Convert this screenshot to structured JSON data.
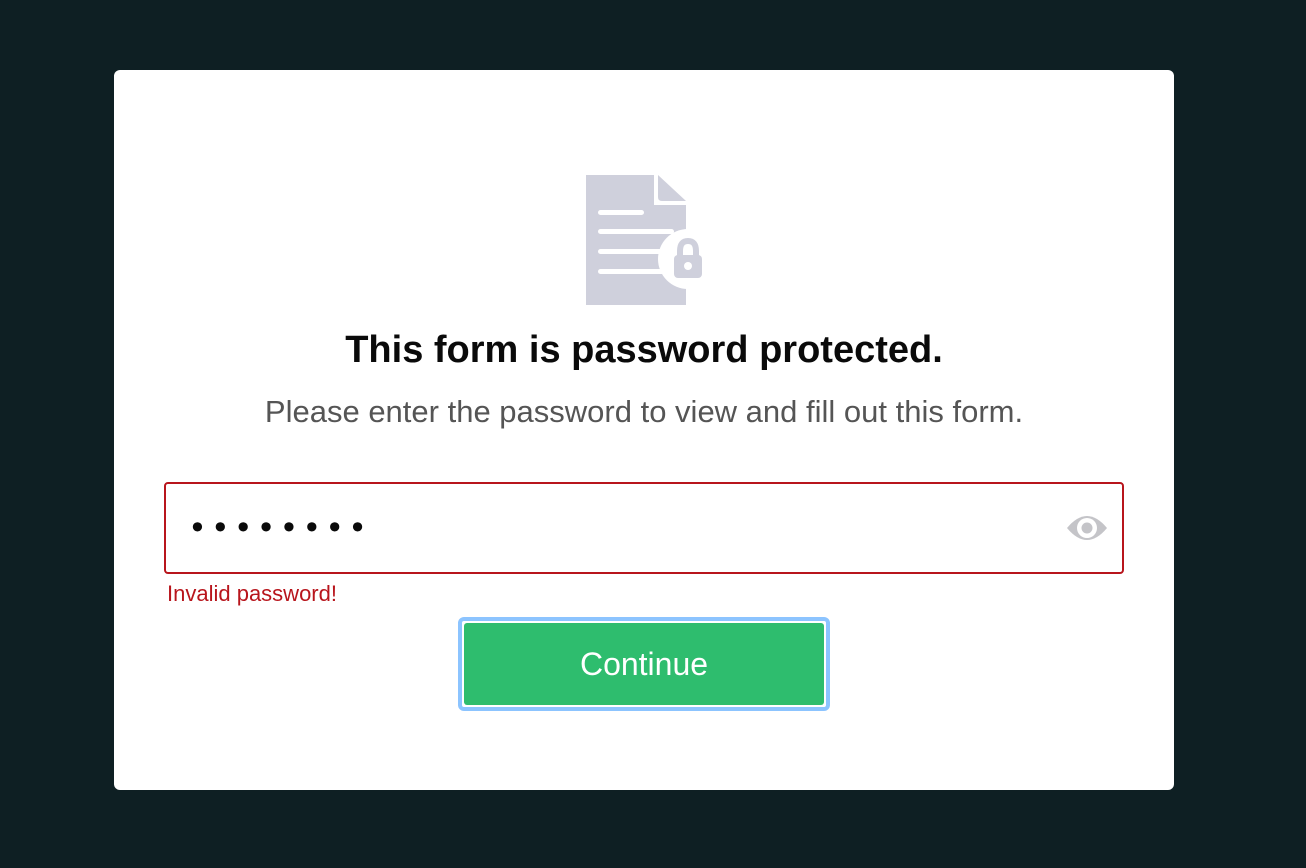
{
  "dialog": {
    "title": "This form is password protected.",
    "subtitle": "Please enter the password to view and fill out this form.",
    "password": {
      "masked_value": "••••••••",
      "show_icon": "eye-icon"
    },
    "error_message": "Invalid password!",
    "continue_label": "Continue"
  },
  "icons": {
    "header": "locked-document-icon"
  },
  "colors": {
    "background": "#0e1f23",
    "card": "#ffffff",
    "error": "#b8151c",
    "button": "#2ebd6e",
    "focus_ring": "#8cc4ff",
    "icon": "#cfd0dc"
  }
}
